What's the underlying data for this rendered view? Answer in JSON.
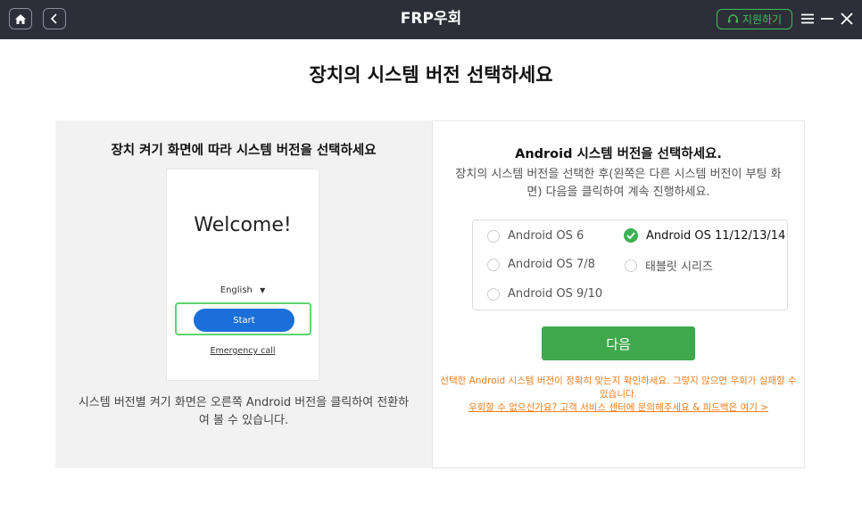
{
  "titlebar": {
    "title": "FRP우회",
    "support_label": "지원하기",
    "home_icon": "home-icon",
    "back_icon": "chevron-left-icon",
    "menu_icon": "menu-icon",
    "minimize_icon": "minimize-icon",
    "close_icon": "close-icon"
  },
  "page": {
    "title": "장치의 시스템 버전 선택하세요"
  },
  "left": {
    "heading": "장치 켜기 화면에 따라 시스템 버전을 선택하세요",
    "phone": {
      "welcome": "Welcome!",
      "language": "English",
      "start": "Start",
      "emergency": "Emergency call"
    },
    "description": "시스템 버전별 켜기 화면은 오른쪽 Android 버전을 클릭하여 전환하여 볼 수 있습니다."
  },
  "right": {
    "heading": "Android 시스템 버전을 선택하세요.",
    "description": "장치의 시스템 버전을 선택한 후(왼쪽은 다른 시스템 버전이 부팅 화면) 다음을 클릭하여 계속 진행하세요.",
    "options": [
      {
        "label": "Android OS 6",
        "selected": false
      },
      {
        "label": "Android OS 11/12/13/14",
        "selected": true
      },
      {
        "label": "Android OS 7/8",
        "selected": false
      },
      {
        "label": "태블릿 시리즈",
        "selected": false
      },
      {
        "label": "Android OS 9/10",
        "selected": false
      }
    ],
    "next_button": "다음",
    "warning": "선택한 Android 시스템 버전이 정확히 맞는지 확인하세요. 그렇지 않으면 우회가 실패할 수 있습니다.",
    "feedback_link": "우회할 수 없으신가요? 고객 서비스 센터에 문의해주세요 & 피드백은 여기 >"
  },
  "colors": {
    "titlebar_bg": "#2c2f38",
    "accent_green": "#3fa84d",
    "warning_orange": "#f07d1a",
    "start_blue": "#1a6fd8"
  }
}
